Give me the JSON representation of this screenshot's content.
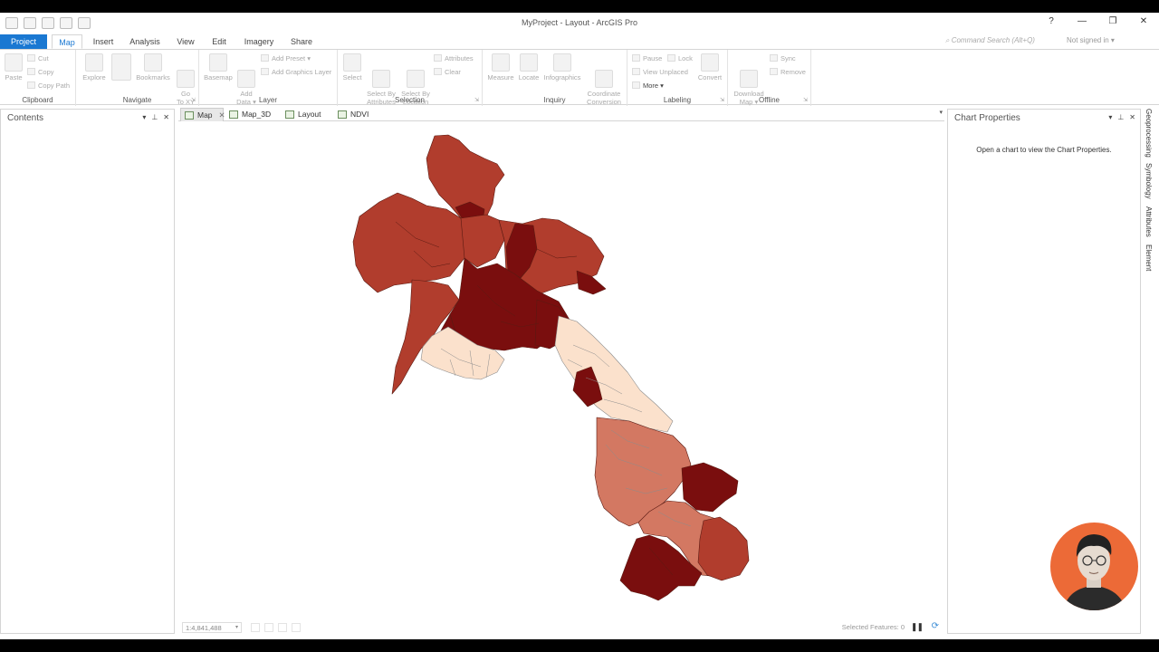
{
  "window": {
    "title": "MyProject - Layout - ArcGIS Pro",
    "help": "?",
    "minimize": "—",
    "restore": "❐",
    "close": "✕"
  },
  "ribbon_tabs": [
    "Project",
    "Map",
    "Insert",
    "Analysis",
    "View",
    "Edit",
    "Imagery",
    "Share"
  ],
  "command_search": "Command Search (Alt+Q)",
  "signin": "Not signed in ▾",
  "clipboard": {
    "label": "Clipboard",
    "paste": "Paste",
    "cut": "Cut",
    "copy": "Copy",
    "copy_path": "Copy Path"
  },
  "navigate": {
    "label": "Navigate",
    "explore": "Explore",
    "bookmarks": "Bookmarks",
    "goto": "Go\nTo XY"
  },
  "layer": {
    "label": "Layer",
    "basemap": "Basemap",
    "add_data": "Add\nData ▾",
    "add_preset": "Add Preset ▾",
    "add_graphics": "Add Graphics Layer"
  },
  "selection": {
    "label": "Selection",
    "select": "Select",
    "by_attr": "Select By\nAttributes",
    "by_loc": "Select By\nLocation",
    "attributes": "Attributes",
    "clear": "Clear"
  },
  "inquiry": {
    "label": "Inquiry",
    "measure": "Measure",
    "locate": "Locate",
    "infographics": "Infographics",
    "coord": "Coordinate\nConversion"
  },
  "labeling": {
    "label": "Labeling",
    "pause": "Pause",
    "lock": "Lock",
    "unplaced": "View Unplaced",
    "more": "More ▾",
    "convert": "Convert"
  },
  "offline": {
    "label": "Offline",
    "download": "Download\nMap ▾",
    "sync": "Sync",
    "remove": "Remove"
  },
  "contents": {
    "title": "Contents"
  },
  "view_tabs": [
    {
      "label": "Map",
      "active": true
    },
    {
      "label": "Map_3D"
    },
    {
      "label": "Layout"
    },
    {
      "label": "NDVI"
    }
  ],
  "status": {
    "scale": "1:4,841,488",
    "selected": "Selected Features: 0"
  },
  "chart_properties": {
    "title": "Chart Properties",
    "message": "Open a chart to view the Chart Properties."
  },
  "side_tabs": [
    "Geoprocessing",
    "Symbology",
    "Attributes",
    "Element"
  ],
  "map_colors": {
    "light": "#fbe1cc",
    "medium": "#d37862",
    "dark_medium": "#b13d2d",
    "dark": "#7a0e0e",
    "boundary": "#8c8c8c"
  }
}
